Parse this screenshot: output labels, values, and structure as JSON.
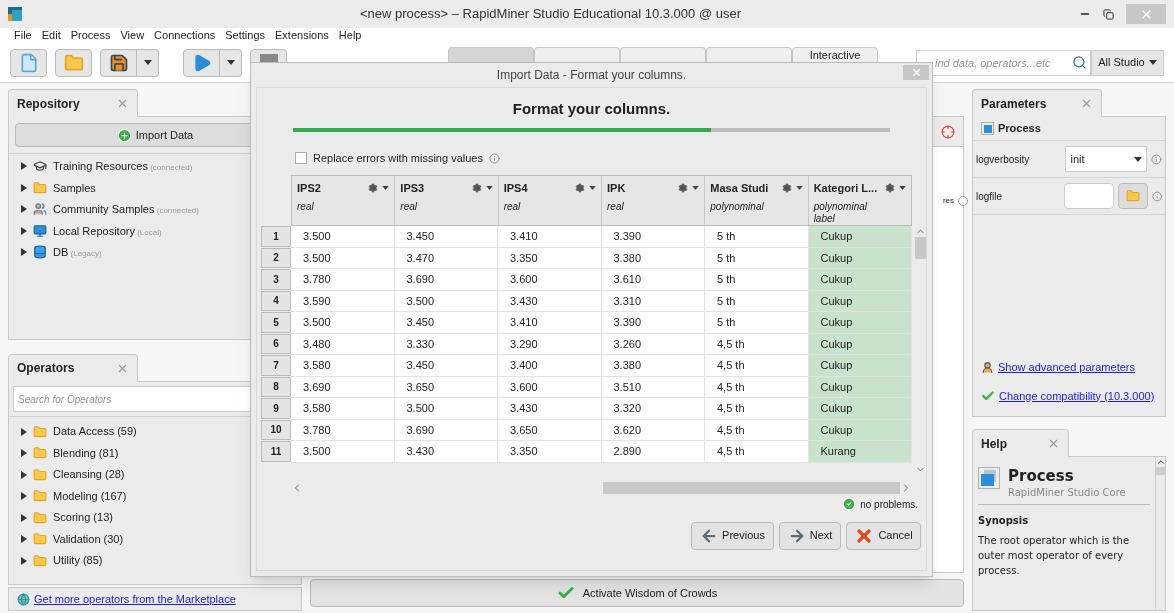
{
  "window": {
    "title": "<new process> – RapidMiner Studio Educational 10.3.000 @ user"
  },
  "menu": [
    "File",
    "Edit",
    "Process",
    "View",
    "Connections",
    "Settings",
    "Extensions",
    "Help"
  ],
  "view_tabs": [
    {
      "selected": true
    },
    {
      "selected": false
    },
    {
      "selected": false
    },
    {
      "selected": false
    },
    {
      "label": "Interactive",
      "selected": false
    }
  ],
  "global_search": {
    "placeholder": "ind data, operators...etc",
    "scope": "All Studio"
  },
  "repository": {
    "title": "Repository",
    "import_button": "Import Data",
    "items": [
      {
        "kind": "training",
        "label": "Training Resources",
        "note": "(connected)"
      },
      {
        "kind": "folder",
        "label": "Samples"
      },
      {
        "kind": "community",
        "label": "Community Samples",
        "note": "(connected)"
      },
      {
        "kind": "local",
        "label": "Local Repository",
        "note": "(Local)"
      },
      {
        "kind": "db",
        "label": "DB",
        "note": "(Legacy)"
      }
    ]
  },
  "operators": {
    "title": "Operators",
    "search_placeholder": "Search for Operators",
    "groups": [
      "Data Access (59)",
      "Blending (81)",
      "Cleansing (28)",
      "Modeling (167)",
      "Scoring (13)",
      "Validation (30)",
      "Utility (85)"
    ],
    "marketplace_link": "Get more operators from the Marketplace"
  },
  "canvas": {
    "port_label": "res"
  },
  "wisdom_button": "Activate Wisdom of Crowds",
  "parameters": {
    "title": "Parameters",
    "operator": "Process",
    "params": [
      {
        "kind": "select",
        "name": "logverbosity",
        "value": "init"
      },
      {
        "kind": "file",
        "name": "logfile"
      }
    ],
    "advanced_link": "Show advanced parameters",
    "compat_link": "Change compatibility (10.3.000)"
  },
  "help": {
    "title": "Help",
    "operator": "Process",
    "subtitle": "RapidMiner Studio Core",
    "section": "Synopsis",
    "text": "The root operator which is the outer most operator of every process."
  },
  "dialog": {
    "title": "Import Data - Format your columns.",
    "heading": "Format your columns.",
    "progress": {
      "level": 0.7
    },
    "replace_errors": {
      "label": "Replace errors with missing values",
      "checked": false
    },
    "columns": [
      {
        "name": "IPS2",
        "type": "real"
      },
      {
        "name": "IPS3",
        "type": "real"
      },
      {
        "name": "IPS4",
        "type": "real"
      },
      {
        "name": "IPK",
        "type": "real"
      },
      {
        "name": "Masa Studi",
        "type": "polynominal"
      },
      {
        "name": "Kategori L...",
        "type": "polynominal",
        "role": "label"
      }
    ],
    "rows": [
      {
        "index": "1",
        "cells": [
          "3.500",
          "3.450",
          "3.410",
          "3.390",
          "5 th",
          "Cukup"
        ]
      },
      {
        "index": "2",
        "cells": [
          "3.500",
          "3.470",
          "3.350",
          "3.380",
          "5 th",
          "Cukup"
        ]
      },
      {
        "index": "3",
        "cells": [
          "3.780",
          "3.690",
          "3.600",
          "3.610",
          "5 th",
          "Cukup"
        ]
      },
      {
        "index": "4",
        "cells": [
          "3.590",
          "3.500",
          "3.430",
          "3.310",
          "5 th",
          "Cukup"
        ]
      },
      {
        "index": "5",
        "cells": [
          "3.500",
          "3.450",
          "3.410",
          "3.390",
          "5 th",
          "Cukup"
        ]
      },
      {
        "index": "6",
        "cells": [
          "3.480",
          "3.330",
          "3.290",
          "3.260",
          "4,5 th",
          "Cukup"
        ]
      },
      {
        "index": "7",
        "cells": [
          "3.580",
          "3.450",
          "3.400",
          "3.380",
          "4,5 th",
          "Cukup"
        ]
      },
      {
        "index": "8",
        "cells": [
          "3.690",
          "3.650",
          "3.600",
          "3.510",
          "4,5 th",
          "Cukup"
        ]
      },
      {
        "index": "9",
        "cells": [
          "3.580",
          "3.500",
          "3.430",
          "3.320",
          "4,5 th",
          "Cukup"
        ]
      },
      {
        "index": "10",
        "cells": [
          "3.780",
          "3.690",
          "3.650",
          "3.620",
          "4,5 th",
          "Cukup"
        ]
      },
      {
        "index": "11",
        "cells": [
          "3.500",
          "3.430",
          "3.350",
          "2.890",
          "4,5 th",
          "Kurang"
        ]
      }
    ],
    "status": "no problems.",
    "previous_button": "Previous",
    "next_button": "Next",
    "cancel_button": "Cancel"
  }
}
